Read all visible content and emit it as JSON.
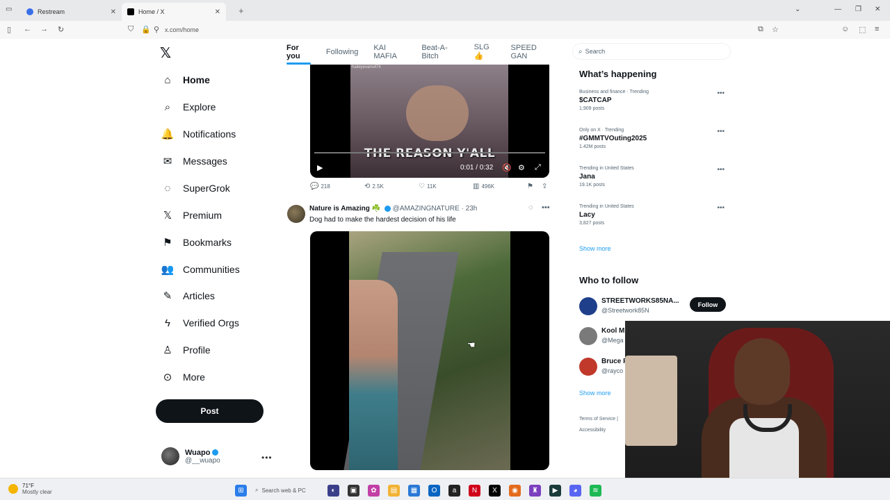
{
  "browser": {
    "tabs": [
      {
        "title": "Restream",
        "active": false
      },
      {
        "title": "Home / X",
        "active": true
      }
    ],
    "url": "x.com/home"
  },
  "nav": {
    "items": [
      {
        "label": "Home",
        "icon": "home-icon",
        "glyph": "⌂"
      },
      {
        "label": "Explore",
        "icon": "search-icon",
        "glyph": "⌕"
      },
      {
        "label": "Notifications",
        "icon": "bell-icon",
        "glyph": "🔔"
      },
      {
        "label": "Messages",
        "icon": "envelope-icon",
        "glyph": "✉"
      },
      {
        "label": "SuperGrok",
        "icon": "grok-icon",
        "glyph": "◌"
      },
      {
        "label": "Premium",
        "icon": "x-premium-icon",
        "glyph": "𝕏"
      },
      {
        "label": "Bookmarks",
        "icon": "bookmark-icon",
        "glyph": "⚑"
      },
      {
        "label": "Communities",
        "icon": "people-icon",
        "glyph": "👥"
      },
      {
        "label": "Articles",
        "icon": "article-icon",
        "glyph": "✎"
      },
      {
        "label": "Verified Orgs",
        "icon": "lightning-icon",
        "glyph": "ϟ"
      },
      {
        "label": "Profile",
        "icon": "person-icon",
        "glyph": "♙"
      },
      {
        "label": "More",
        "icon": "more-circle-icon",
        "glyph": "⊙"
      }
    ],
    "post_label": "Post",
    "user": {
      "name": "Wuapo",
      "handle": "@__wuapo"
    }
  },
  "feed_tabs": [
    "For you",
    "Following",
    "KAI MAFIA",
    "Beat-A-Bitch",
    "SLG👍",
    "SPEED GAN"
  ],
  "tweet1": {
    "watermark": "haileyevans474",
    "caption": "THE REASON Y'ALL",
    "time": "0:01 / 0:32",
    "actions": {
      "replies": "218",
      "reposts": "2.5K",
      "likes": "11K",
      "views": "496K"
    }
  },
  "tweet2": {
    "name": "Nature is Amazing ☘️",
    "handle": "@AMAZINGNATURE · 23h",
    "text": "Dog had to make the hardest decision of his life"
  },
  "search": {
    "placeholder": "Search"
  },
  "trending": {
    "title": "What’s happening",
    "items": [
      {
        "meta": "Business and finance · Trending",
        "name": "$CATCAP",
        "count": "1,909 posts"
      },
      {
        "meta": "Only on X · Trending",
        "name": "#GMMTVOuting2025",
        "count": "1.42M posts"
      },
      {
        "meta": "Trending in United States",
        "name": "Jana",
        "count": "19.1K posts"
      },
      {
        "meta": "Trending in United States",
        "name": "Lacy",
        "count": "3,827 posts"
      }
    ],
    "show_more": "Show more"
  },
  "who_to_follow": {
    "title": "Who to follow",
    "items": [
      {
        "name": "STREETWORKS85NA...",
        "handle": "@Streetwork85N",
        "color": "#1f3f8a"
      },
      {
        "name": "Kool M",
        "handle": "@Mega",
        "color": "#7a7a7a"
      },
      {
        "name": "Bruce F",
        "handle": "@rayco",
        "color": "#c0392b"
      }
    ],
    "follow_label": "Follow",
    "show_more": "Show more"
  },
  "footer": {
    "line1": "Terms of Service |",
    "line2": "Accessibility"
  },
  "taskbar": {
    "temp": "71°F",
    "condition": "Mostly clear",
    "search_placeholder": "Search web & PC"
  }
}
